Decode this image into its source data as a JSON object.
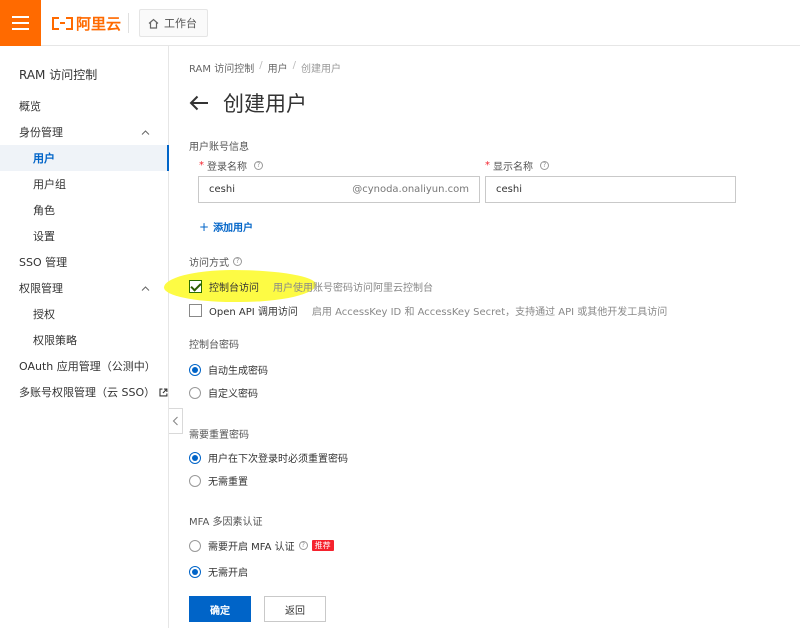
{
  "colors": {
    "brand": "#ff6a00",
    "primary": "#0064c8",
    "required": "#f5222d",
    "highlight": "#fdfb3a"
  },
  "topbar": {
    "menu_icon": "hamburger-icon",
    "logo_text": "阿里云",
    "workbench_label": "工作台",
    "workbench_icon": "home-icon"
  },
  "sidebar": {
    "title": "RAM 访问控制",
    "items": [
      {
        "label": "概览"
      },
      {
        "label": "身份管理"
      },
      {
        "label": "用户"
      },
      {
        "label": "用户组"
      },
      {
        "label": "角色"
      },
      {
        "label": "设置"
      },
      {
        "label": "SSO 管理"
      },
      {
        "label": "权限管理"
      },
      {
        "label": "授权"
      },
      {
        "label": "权限策略"
      },
      {
        "label": "OAuth 应用管理（公测中）"
      },
      {
        "label": "多账号权限管理（云 SSO）"
      }
    ]
  },
  "breadcrumb": {
    "items": [
      "RAM 访问控制",
      "用户",
      "创建用户"
    ],
    "separator": "/"
  },
  "page": {
    "title": "创建用户"
  },
  "account": {
    "section_label": "用户账号信息",
    "login_name": {
      "label": "登录名称",
      "value": "ceshi",
      "suffix": "@cynoda.onaliyun.com"
    },
    "display_name": {
      "label": "显示名称",
      "value": "ceshi"
    },
    "add_user_label": "添加用户"
  },
  "access": {
    "section_label": "访问方式",
    "console": {
      "label": "控制台访问",
      "desc": "用户使用账号密码访问阿里云控制台",
      "checked": true
    },
    "openapi": {
      "label": "Open API 调用访问",
      "desc": "启用 AccessKey ID 和 AccessKey Secret，支持通过 API 或其他开发工具访问",
      "checked": false
    }
  },
  "console_password": {
    "section_label": "控制台密码",
    "options": [
      {
        "label": "自动生成密码",
        "selected": true
      },
      {
        "label": "自定义密码",
        "selected": false
      }
    ]
  },
  "reset_password": {
    "section_label": "需要重置密码",
    "options": [
      {
        "label": "用户在下次登录时必须重置密码",
        "selected": true
      },
      {
        "label": "无需重置",
        "selected": false
      }
    ]
  },
  "mfa": {
    "section_label": "MFA 多因素认证",
    "options": [
      {
        "label": "需要开启 MFA 认证",
        "selected": false,
        "badge": "推荐"
      },
      {
        "label": "无需开启",
        "selected": true
      }
    ]
  },
  "actions": {
    "confirm_label": "确定",
    "back_label": "返回"
  }
}
